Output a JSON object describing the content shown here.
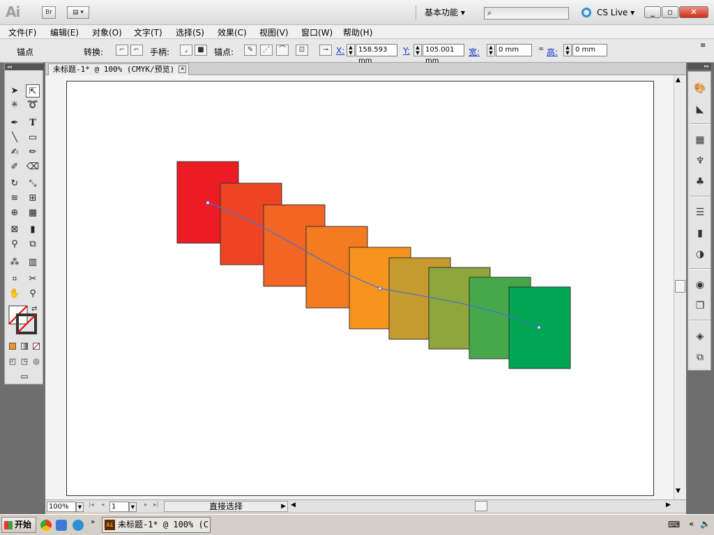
{
  "app": {
    "logo": "Ai",
    "bridge_label": "Br",
    "workspace": "基本功能",
    "search_placeholder": "",
    "cs_live": "CS Live",
    "window_buttons": {
      "minimize": "_",
      "restore": "▫",
      "close": "✕"
    }
  },
  "menu": {
    "items": [
      "文件(F)",
      "编辑(E)",
      "对象(O)",
      "文字(T)",
      "选择(S)",
      "效果(C)",
      "视图(V)",
      "窗口(W)",
      "帮助(H)"
    ]
  },
  "control": {
    "anchor_label": "锚点",
    "convert_label": "转换:",
    "handle_label": "手柄:",
    "anchor_points_label": "锚点:",
    "x_label": "X:",
    "x_value": "158.593 mm",
    "y_label": "Y:",
    "y_value": "105.001 mm",
    "w_label": "宽:",
    "w_value": "0 mm",
    "h_label": "高:",
    "h_value": "0 mm"
  },
  "document": {
    "tab_title": "未标题-1* @ 100% (CMYK/预览)",
    "squares": [
      {
        "color": "#ed1c24"
      },
      {
        "color": "#ee4424"
      },
      {
        "color": "#f26522"
      },
      {
        "color": "#f47b20"
      },
      {
        "color": "#f7941d"
      },
      {
        "color": "#c59b2d"
      },
      {
        "color": "#8fa63d"
      },
      {
        "color": "#45a84b"
      },
      {
        "color": "#00a651"
      }
    ],
    "path_color": "#4a6fd8"
  },
  "status": {
    "zoom": "100%",
    "page": "1",
    "tool_name": "直接选择"
  },
  "taskbar": {
    "start_label": "开始",
    "task_label": "未标题-1* @ 100% (C..."
  }
}
